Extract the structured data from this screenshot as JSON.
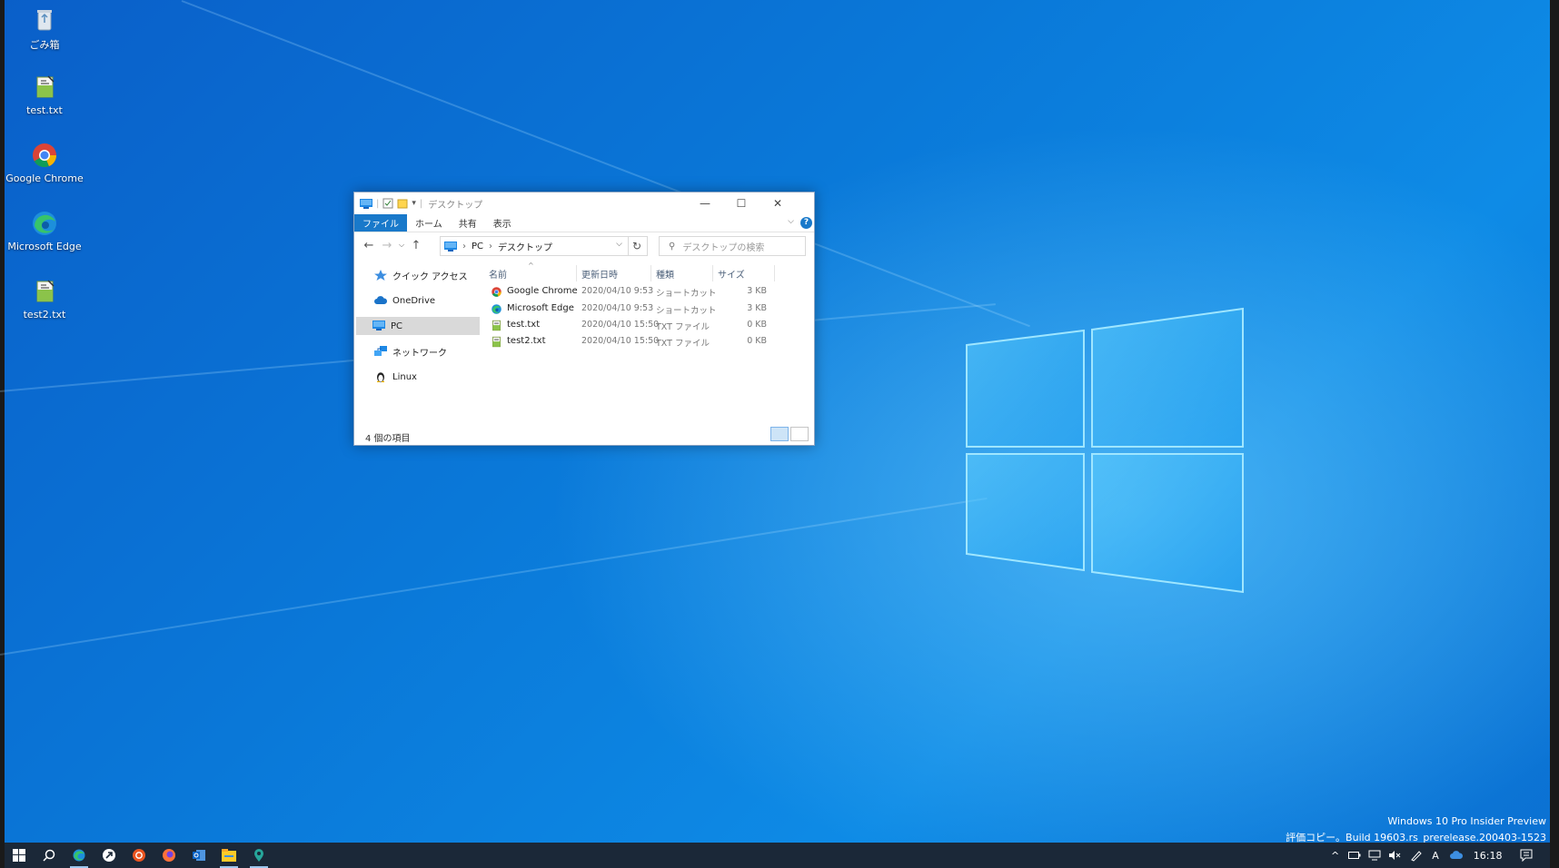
{
  "desktop_icons": [
    {
      "label": "ごみ箱",
      "icon": "recycle-bin-icon"
    },
    {
      "label": "test.txt",
      "icon": "text-file-icon"
    },
    {
      "label": "Google Chrome",
      "icon": "chrome-icon"
    },
    {
      "label": "Microsoft Edge",
      "icon": "edge-icon"
    },
    {
      "label": "test2.txt",
      "icon": "text-file-icon"
    }
  ],
  "explorer": {
    "title": "デスクトップ",
    "ribbon_tabs": [
      "ファイル",
      "ホーム",
      "共有",
      "表示"
    ],
    "help_label": "?",
    "address": {
      "root": "PC",
      "current": "デスクトップ"
    },
    "search_placeholder": "デスクトップの検索",
    "nav_items": [
      {
        "label": "クイック アクセス",
        "icon": "star-icon"
      },
      {
        "label": "OneDrive",
        "icon": "cloud-icon"
      },
      {
        "label": "PC",
        "icon": "computer-icon",
        "selected": true
      },
      {
        "label": "ネットワーク",
        "icon": "network-icon"
      },
      {
        "label": "Linux",
        "icon": "linux-penguin-icon"
      }
    ],
    "columns": [
      "名前",
      "更新日時",
      "種類",
      "サイズ"
    ],
    "files": [
      {
        "name": "Google Chrome",
        "date": "2020/04/10 9:53",
        "type": "ショートカット",
        "size": "3 KB",
        "icon": "chrome-icon"
      },
      {
        "name": "Microsoft Edge",
        "date": "2020/04/10 9:53",
        "type": "ショートカット",
        "size": "3 KB",
        "icon": "edge-icon"
      },
      {
        "name": "test.txt",
        "date": "2020/04/10 15:50",
        "type": "TXT ファイル",
        "size": "0 KB",
        "icon": "text-file-icon"
      },
      {
        "name": "test2.txt",
        "date": "2020/04/10 15:50",
        "type": "TXT ファイル",
        "size": "0 KB",
        "icon": "text-file-icon"
      }
    ],
    "status": "4 個の項目"
  },
  "watermark": {
    "line1": "Windows 10 Pro Insider Preview",
    "line2": "評価コピー。Build 19603.rs_prerelease.200403-1523"
  },
  "taskbar": {
    "clock": "16:18",
    "apps": [
      "start-icon",
      "search-icon",
      "edge-icon",
      "app-icon",
      "ubuntu-icon",
      "firefox-icon",
      "outlook-icon",
      "file-explorer-icon",
      "maps-icon"
    ]
  },
  "colors": {
    "accent": "#1979ca",
    "taskbar": "#1b2838",
    "desktop": "#0a78d8"
  }
}
